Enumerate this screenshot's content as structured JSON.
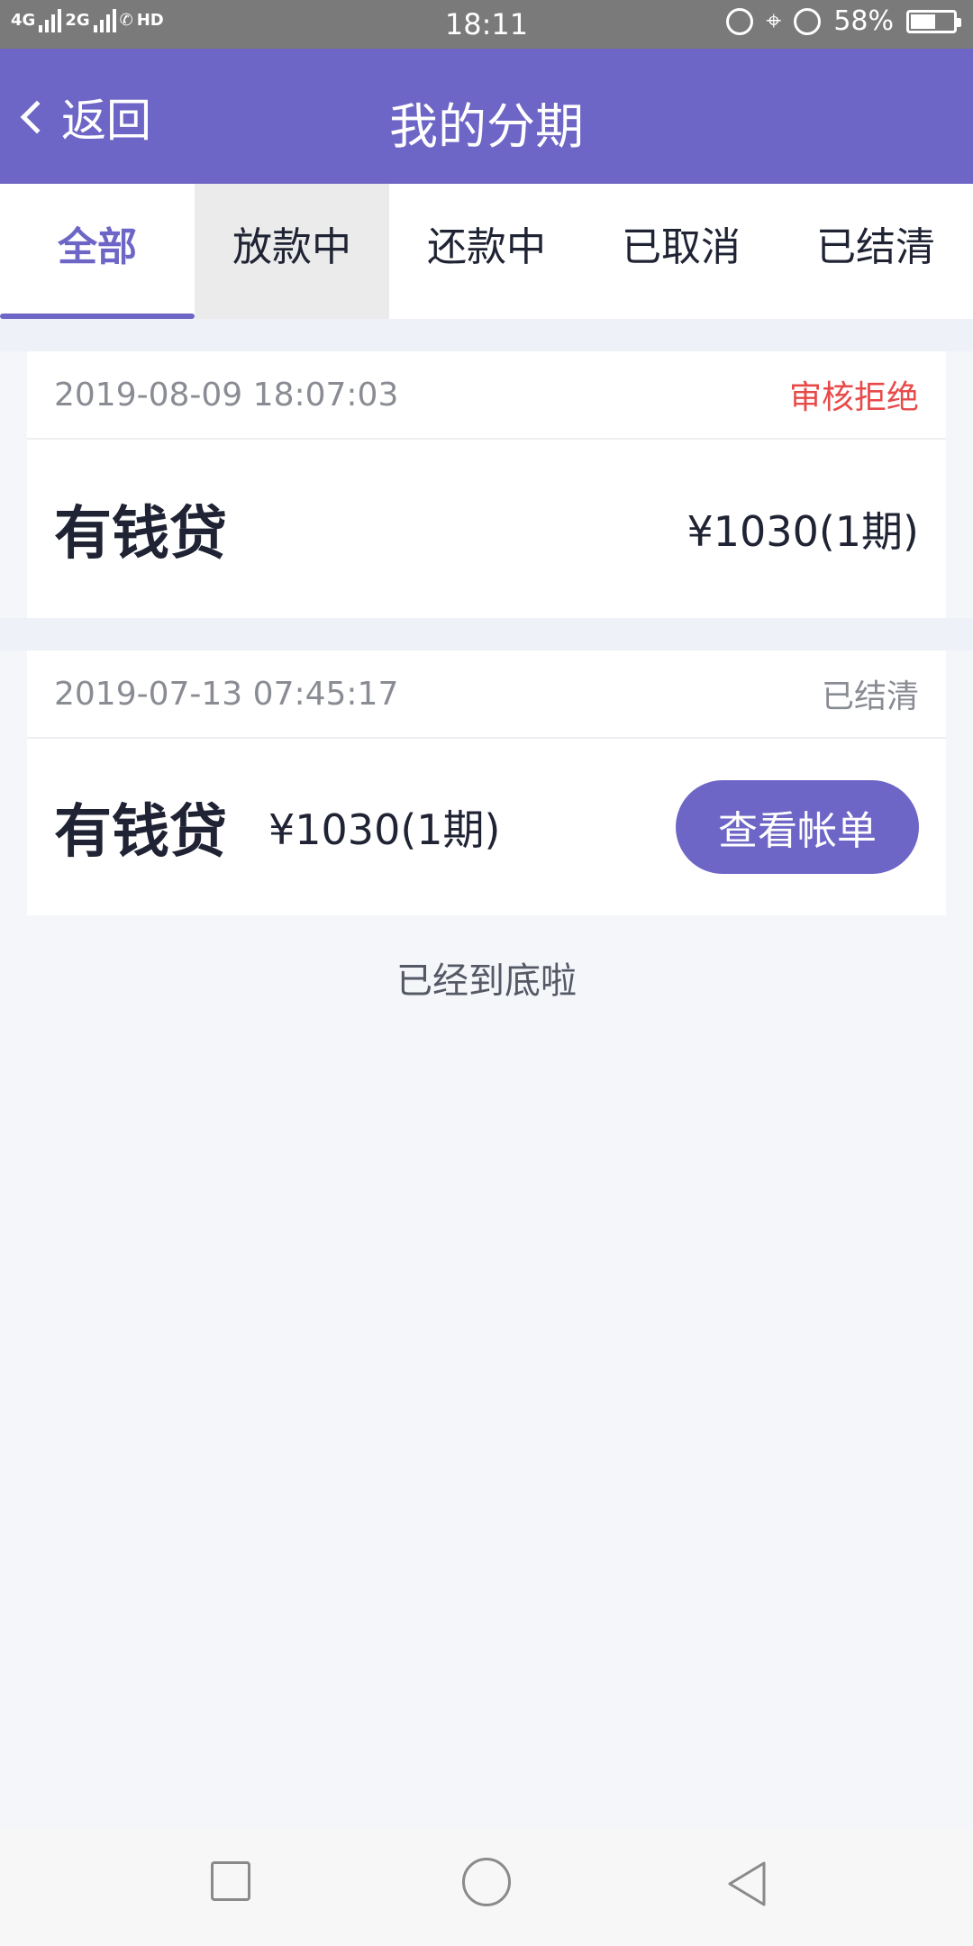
{
  "status_bar": {
    "network_1": "4G",
    "network_2": "2G",
    "call_badge": "HD",
    "time": "18:11",
    "battery": "58%",
    "battery_level": 0.58
  },
  "header": {
    "back_label": "返回",
    "title": "我的分期"
  },
  "tabs": [
    {
      "label": "全部"
    },
    {
      "label": "放款中"
    },
    {
      "label": "还款中"
    },
    {
      "label": "已取消"
    },
    {
      "label": "已结清"
    }
  ],
  "orders": [
    {
      "time": "2019-08-09 18:07:03",
      "status": "审核拒绝",
      "product": "有钱贷",
      "amount": "¥1030(1期)"
    },
    {
      "time": "2019-07-13 07:45:17",
      "status": "已结清",
      "product": "有钱贷",
      "amount": "¥1030(1期)",
      "action": "查看帐单"
    }
  ],
  "end_text": "已经到底啦",
  "colors": {
    "primary": "#6e66c6",
    "status_reject": "#e84a4a",
    "status_settled": "#8a8c94"
  }
}
